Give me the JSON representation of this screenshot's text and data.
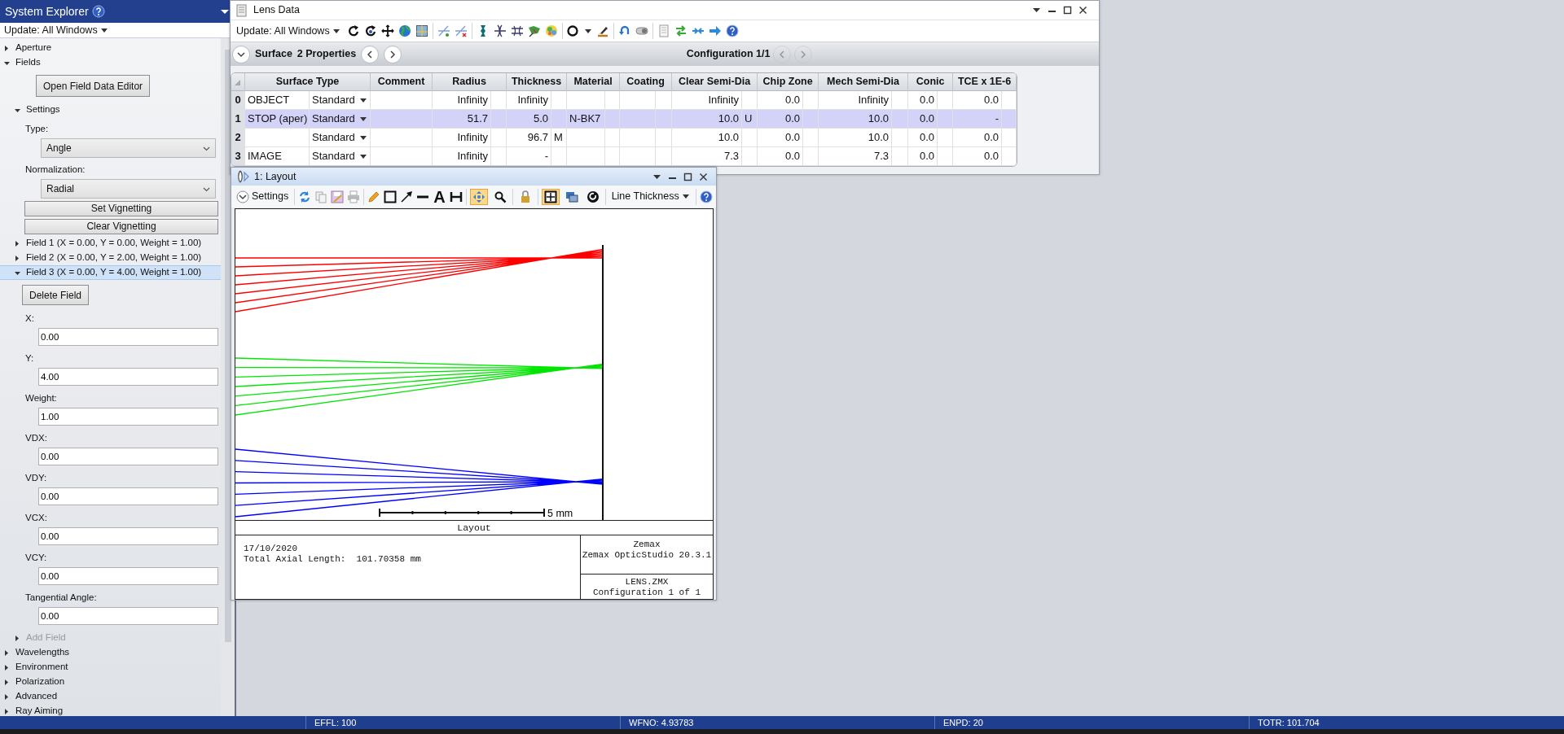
{
  "system_explorer": {
    "title": "System Explorer",
    "update_menu": "Update: All Windows",
    "tree": [
      {
        "kind": "node",
        "label": "Aperture",
        "expanded": false,
        "selected": false,
        "disabled": false
      },
      {
        "kind": "node",
        "label": "Fields",
        "expanded": true,
        "selected": false,
        "disabled": false,
        "children": [
          {
            "kind": "button",
            "label": "Open Field Data Editor"
          },
          {
            "kind": "node",
            "label": "Settings",
            "expanded": true,
            "selected": false,
            "disabled": false,
            "children": [
              {
                "kind": "select",
                "label": "Type:",
                "value": "Angle"
              },
              {
                "kind": "select",
                "label": "Normalization:",
                "value": "Radial"
              },
              {
                "kind": "wide-button",
                "label": "Set Vignetting"
              },
              {
                "kind": "wide-button",
                "label": "Clear Vignetting"
              }
            ]
          },
          {
            "kind": "node",
            "label": "Field 1 (X = 0.00, Y = 0.00, Weight = 1.00)",
            "expanded": false,
            "selected": false,
            "disabled": false
          },
          {
            "kind": "node",
            "label": "Field 2 (X = 0.00, Y = 2.00, Weight = 1.00)",
            "expanded": false,
            "selected": false,
            "disabled": false
          },
          {
            "kind": "node",
            "label": "Field 3 (X = 0.00, Y = 4.00, Weight = 1.00)",
            "expanded": true,
            "selected": true,
            "disabled": false,
            "children": [
              {
                "kind": "button",
                "label": "Delete Field"
              },
              {
                "kind": "input",
                "label": "X:",
                "value": "0.00"
              },
              {
                "kind": "input",
                "label": "Y:",
                "value": "4.00"
              },
              {
                "kind": "input",
                "label": "Weight:",
                "value": "1.00"
              },
              {
                "kind": "input",
                "label": "VDX:",
                "value": "0.00"
              },
              {
                "kind": "input",
                "label": "VDY:",
                "value": "0.00"
              },
              {
                "kind": "input",
                "label": "VCX:",
                "value": "0.00"
              },
              {
                "kind": "input",
                "label": "VCY:",
                "value": "0.00"
              },
              {
                "kind": "input",
                "label": "Tangential Angle:",
                "value": "0.00"
              }
            ]
          },
          {
            "kind": "node",
            "label": "Add Field",
            "expanded": false,
            "selected": false,
            "disabled": true
          }
        ]
      },
      {
        "kind": "node",
        "label": "Wavelengths",
        "expanded": false,
        "selected": false,
        "disabled": false
      },
      {
        "kind": "node",
        "label": "Environment",
        "expanded": false,
        "selected": false,
        "disabled": false
      },
      {
        "kind": "node",
        "label": "Polarization",
        "expanded": false,
        "selected": false,
        "disabled": false
      },
      {
        "kind": "node",
        "label": "Advanced",
        "expanded": false,
        "selected": false,
        "disabled": false
      },
      {
        "kind": "node",
        "label": "Ray Aiming",
        "expanded": false,
        "selected": false,
        "disabled": false
      }
    ]
  },
  "lens_data": {
    "title": "Lens Data",
    "update_menu": "Update: All Windows",
    "surface_label": "Surface",
    "properties_label": "2 Properties",
    "surface_nav": {
      "disabled": false
    },
    "configuration": "Configuration 1/1",
    "config_nav": {
      "disabled": true
    },
    "columns": [
      "Surface Type",
      "Comment",
      "Radius",
      "Thickness",
      "Material",
      "Coating",
      "Clear Semi-Dia",
      "Chip Zone",
      "Mech Semi-Dia",
      "Conic",
      "TCE x 1E-6"
    ],
    "rows": [
      {
        "number": "0",
        "selected": false,
        "cells": [
          {
            "name": "OBJECT",
            "type": "Standard"
          },
          {},
          {
            "value": "Infinity"
          },
          {
            "value": "Infinity"
          },
          {},
          {},
          {
            "value": "Infinity"
          },
          {
            "value": "0.0"
          },
          {
            "value": "Infinity"
          },
          {
            "value": "0.0"
          },
          {
            "value": "0.0"
          }
        ]
      },
      {
        "number": "1",
        "selected": true,
        "cells": [
          {
            "name": "STOP (aper)",
            "type": "Standard"
          },
          {},
          {
            "value": "51.7"
          },
          {
            "value": "5.0"
          },
          {
            "value": "N-BK7"
          },
          {},
          {
            "value": "10.0",
            "solve": "U"
          },
          {
            "value": "0.0"
          },
          {
            "value": "10.0"
          },
          {
            "value": "0.0"
          },
          {
            "value": "-"
          }
        ]
      },
      {
        "number": "2",
        "selected": false,
        "cells": [
          {
            "type": "Standard"
          },
          {},
          {
            "value": "Infinity"
          },
          {
            "value": "96.7",
            "solve": "M"
          },
          {},
          {},
          {
            "value": "10.0"
          },
          {
            "value": "0.0"
          },
          {
            "value": "10.0"
          },
          {
            "value": "0.0"
          },
          {
            "value": "0.0"
          }
        ]
      },
      {
        "number": "3",
        "selected": false,
        "cells": [
          {
            "name": "IMAGE",
            "type": "Standard"
          },
          {},
          {
            "value": "Infinity"
          },
          {
            "value": "-"
          },
          {},
          {},
          {
            "value": "7.3"
          },
          {
            "value": "0.0"
          },
          {
            "value": "7.3"
          },
          {
            "value": "0.0"
          },
          {
            "value": "0.0"
          }
        ]
      }
    ]
  },
  "layout": {
    "title": "1: Layout",
    "settings": "Settings",
    "text_tool": "A",
    "line_thickness": "Line Thickness",
    "tools": [
      {
        "kind": "move",
        "pressed": true
      },
      {
        "kind": "zoom",
        "pressed": false
      },
      {
        "kind": "lock",
        "pressed": false
      },
      {
        "kind": "frame",
        "pressed": true
      },
      {
        "kind": "windows",
        "pressed": false
      },
      {
        "kind": "reset",
        "pressed": false
      }
    ],
    "ray_bundles": [
      {
        "color": "#ff0000"
      },
      {
        "color": "#00e600"
      },
      {
        "color": "#0000ff"
      }
    ],
    "scale_label": "5 mm",
    "plot_title": "Layout",
    "date": "17/10/2020",
    "total_length": "Total Axial Length:  101.70358 mm",
    "company": "Zemax",
    "product": "Zemax OpticStudio 20.3.1",
    "file": "LENS.ZMX",
    "configuration": "Configuration 1 of 1"
  },
  "status_bar": [
    "EFFL: 100",
    "WFNO: 4.93783",
    "ENPD: 20",
    "TOTR: 101.704"
  ]
}
